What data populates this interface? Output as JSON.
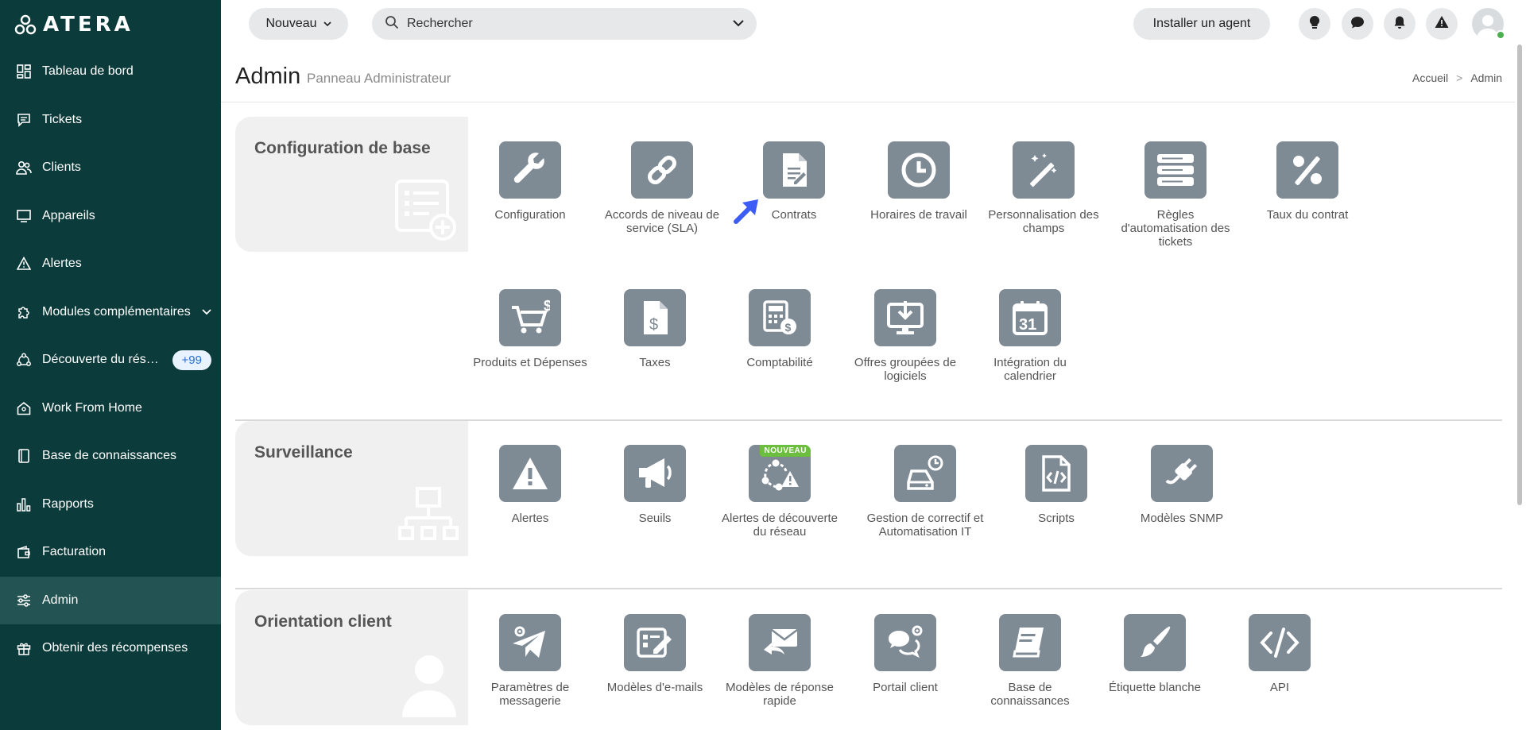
{
  "app": {
    "logo_text": "ATERA"
  },
  "sidebar": {
    "items": [
      {
        "label": "Tableau de bord",
        "icon": "dashboard-icon"
      },
      {
        "label": "Tickets",
        "icon": "ticket-icon"
      },
      {
        "label": "Clients",
        "icon": "clients-icon"
      },
      {
        "label": "Appareils",
        "icon": "monitor-icon"
      },
      {
        "label": "Alertes",
        "icon": "alert-icon"
      },
      {
        "label": "Modules complémentaires",
        "icon": "puzzle-icon"
      },
      {
        "label": "Découverte du rés…",
        "icon": "network-discovery-icon",
        "badge": "+99"
      },
      {
        "label": "Work From Home",
        "icon": "home-icon"
      },
      {
        "label": "Base de connaissances",
        "icon": "book-icon"
      },
      {
        "label": "Rapports",
        "icon": "reports-icon"
      },
      {
        "label": "Facturation",
        "icon": "wallet-icon"
      },
      {
        "label": "Admin",
        "icon": "sliders-icon",
        "active": true
      },
      {
        "label": "Obtenir des récompenses",
        "icon": "gift-icon"
      }
    ]
  },
  "topbar": {
    "new_label": "Nouveau",
    "search_placeholder": "Rechercher",
    "install_label": "Installer un agent"
  },
  "page": {
    "title": "Admin",
    "subtitle": "Panneau Administrateur",
    "breadcrumb": [
      "Accueil",
      ">",
      "Admin"
    ]
  },
  "sections": {
    "base": {
      "title": "Configuration de base",
      "tiles": [
        "Configuration",
        "Accords de niveau de service (SLA)",
        "Contrats",
        "Horaires de travail",
        "Personnalisation des champs",
        "Règles d'automatisation des tickets",
        "Taux du contrat",
        "Produits et Dépenses",
        "Taxes",
        "Comptabilité",
        "Offres groupées de logiciels",
        "Intégration du calendrier"
      ]
    },
    "surveillance": {
      "title": "Surveillance",
      "tiles": [
        "Alertes",
        "Seuils",
        "Alertes de découverte du réseau",
        "Gestion de correctif et Automatisation IT",
        "Scripts",
        "Modèles SNMP"
      ],
      "new_badge": "NOUVEAU"
    },
    "client": {
      "title": "Orientation client",
      "tiles": [
        "Paramètres de messagerie",
        "Modèles d'e-mails",
        "Modèles de réponse rapide",
        "Portail client",
        "Base de connaissances",
        "Étiquette blanche",
        "API"
      ]
    }
  },
  "colors": {
    "sidebar_bg": "#0b3b3a",
    "sidebar_active": "#235352",
    "tile_icon_bg": "#7e8a94",
    "badge_new": "#6cbf3e",
    "cursor_arrow": "#3d5cf5"
  }
}
